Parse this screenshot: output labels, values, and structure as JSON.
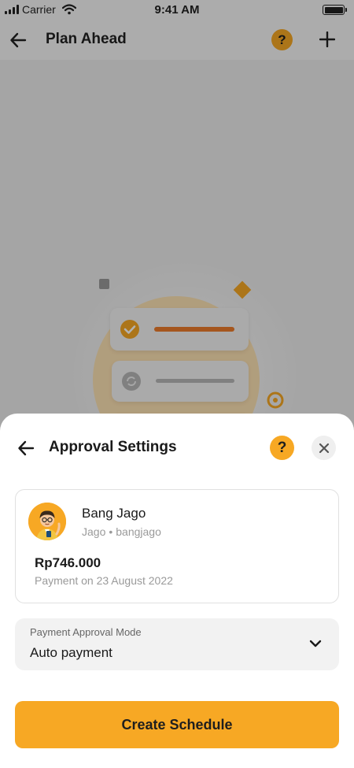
{
  "status_bar": {
    "carrier": "Carrier",
    "time": "9:41 AM"
  },
  "header": {
    "title": "Plan Ahead",
    "help_label": "?"
  },
  "sheet": {
    "title": "Approval Settings",
    "help_label": "?",
    "payee": {
      "name": "Bang Jago",
      "bank": "Jago",
      "separator": "•",
      "username": "bangjago",
      "amount": "Rp746.000",
      "payment_date": "Payment on 23 August 2022"
    },
    "approval_mode": {
      "label": "Payment Approval Mode",
      "value": "Auto payment"
    },
    "create_button_label": "Create Schedule"
  },
  "colors": {
    "accent": "#f7a824",
    "overlay": "rgba(0,0,0,0.30)",
    "card_border": "#e0e0e0",
    "muted_text": "#9a9a9a"
  },
  "icons": {
    "back": "arrow-left-icon",
    "help": "question-circle-icon",
    "add": "plus-icon",
    "close": "close-icon",
    "dropdown": "chevron-down-icon",
    "wifi": "wifi-icon",
    "battery": "battery-icon"
  }
}
